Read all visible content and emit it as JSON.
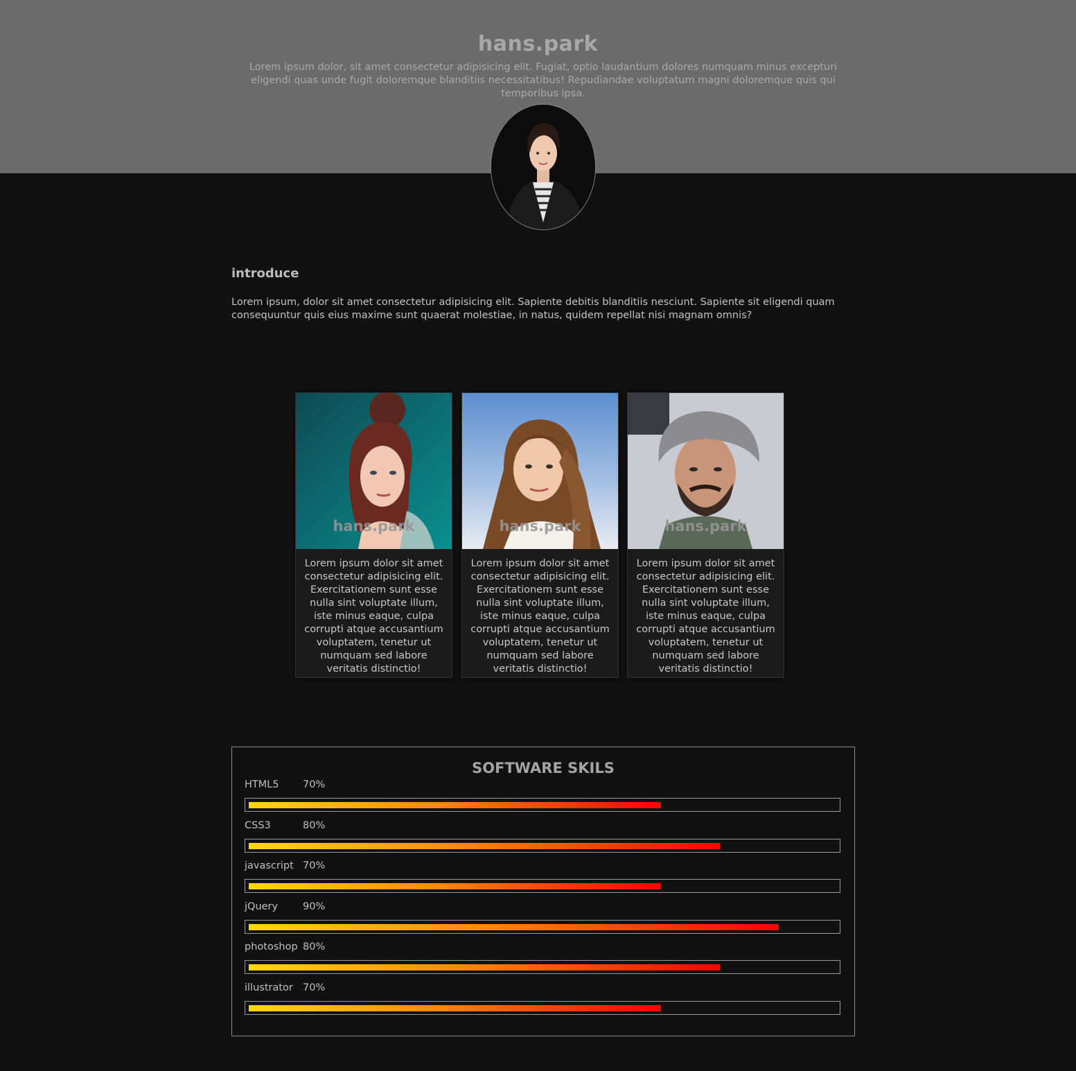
{
  "hero": {
    "title": "hans.park",
    "description": "Lorem ipsum dolor, sit amet consectetur adipisicing elit. Fugiat, optio laudantium dolores numquam minus excepturi eligendi quas unde fugit doloremque blanditiis necessitatibus! Repudiandae voluptatum magni doloremque quis qui temporibus ipsa."
  },
  "intro": {
    "title": "introduce",
    "text": "Lorem ipsum, dolor sit amet consectetur adipisicing elit. Sapiente debitis blanditiis nesciunt. Sapiente sit eligendi quam consequuntur quis eius maxime sunt quaerat molestiae, in natus, quidem repellat nisi magnam omnis?"
  },
  "cards": [
    {
      "name": "hans.park",
      "text": "Lorem ipsum dolor sit amet consectetur adipisicing elit. Exercitationem sunt esse nulla sint voluptate illum, iste minus eaque, culpa corrupti atque accusantium voluptatem, tenetur ut numquam sed labore veritatis distinctio!"
    },
    {
      "name": "hans.park",
      "text": "Lorem ipsum dolor sit amet consectetur adipisicing elit. Exercitationem sunt esse nulla sint voluptate illum, iste minus eaque, culpa corrupti atque accusantium voluptatem, tenetur ut numquam sed labore veritatis distinctio!"
    },
    {
      "name": "hans.park",
      "text": "Lorem ipsum dolor sit amet consectetur adipisicing elit. Exercitationem sunt esse nulla sint voluptate illum, iste minus eaque, culpa corrupti atque accusantium voluptatem, tenetur ut numquam sed labore veritatis distinctio!"
    }
  ],
  "skills": {
    "title": "SOFTWARE SKILS",
    "items": [
      {
        "name": "HTML5",
        "percent_label": "70%",
        "value": 70
      },
      {
        "name": "CSS3",
        "percent_label": "80%",
        "value": 80
      },
      {
        "name": "javascript",
        "percent_label": "70%",
        "value": 70
      },
      {
        "name": "jQuery",
        "percent_label": "90%",
        "value": 90
      },
      {
        "name": "photoshop",
        "percent_label": "80%",
        "value": 80
      },
      {
        "name": "illustrator",
        "percent_label": "70%",
        "value": 70
      }
    ]
  }
}
